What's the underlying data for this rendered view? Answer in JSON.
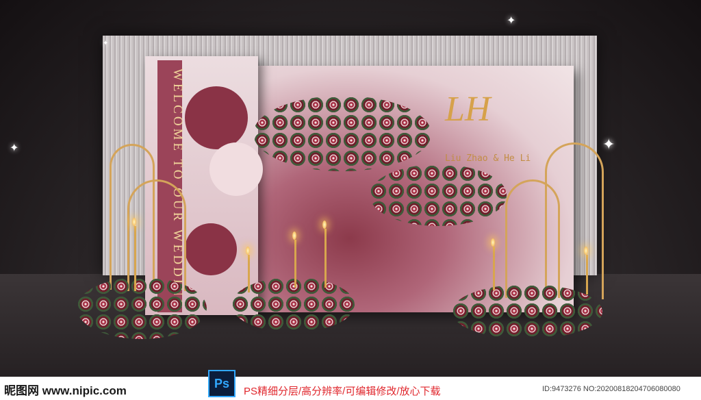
{
  "scene": {
    "ribbon_text": "WELCOME TO OUR WEDDING",
    "monogram": "LH",
    "names": "Liu Zhao & He Li"
  },
  "footer": {
    "site": "昵图网 www.nipic.com",
    "ps_badge": "Ps",
    "tagline": "PS精细分层/高分辨率/可编辑修改/放心下载",
    "id_text": "ID:9473276 NO:20200818204706080080"
  },
  "colors": {
    "wine": "#8a3346",
    "blush": "#f1dde0",
    "gold": "#d4a45a",
    "accent_red": "#e0272d"
  }
}
